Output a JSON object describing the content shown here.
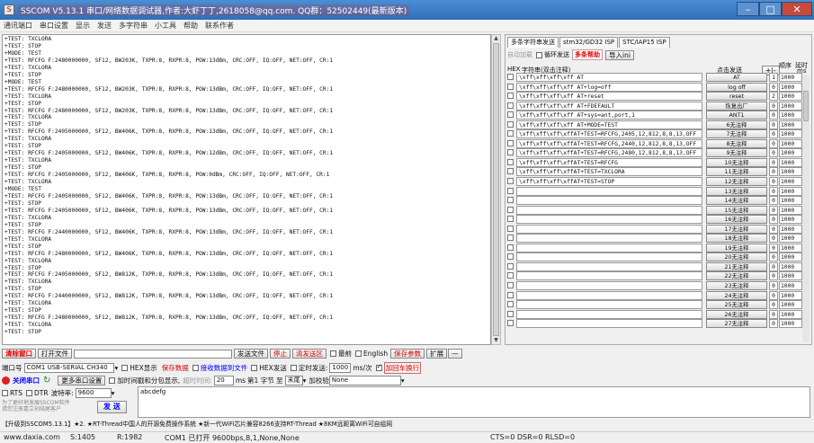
{
  "window": {
    "title": "SSCOM V5.13.1 串口/网络数据调试器,作者:大虾丁丁,2618058@qq.com. QQ群：52502449(最新版本)",
    "minimize": "–",
    "maximize": "□",
    "close": "✕"
  },
  "menu": [
    "通讯端口",
    "串口设置",
    "显示",
    "发送",
    "多字符串",
    "小工具",
    "帮助",
    "联系作者"
  ],
  "receive_text": "+TEST: TXCLORA\n+TEST: STOP\n+MODE: TEST\n+TEST: RFCFG F:2480000000, SF12, BW203K, TXPR:8, RXPR:8, POW:13dBm, CRC:OFF, IQ:OFF, NET:OFF, CR:1\n+TEST: TXCLORA\n+TEST: STOP\n+MODE: TEST\n+TEST: RFCFG F:2480000000, SF12, BW203K, TXPR:8, RXPR:8, POW:13dBm, CRC:OFF, IQ:OFF, NET:OFF, CR:1\n+TEST: TXCLORA\n+TEST: STOP\n+TEST: RFCFG F:2480000000, SF12, BW203K, TXPR:8, RXPR:8, POW:13dBm, CRC:OFF, IQ:OFF, NET:OFF, CR:1\n+TEST: TXCLORA\n+TEST: STOP\n+TEST: RFCFG F:2405000000, SF12, BW406K, TXPR:8, RXPR:8, POW:13dBm, CRC:OFF, IQ:OFF, NET:OFF, CR:1\n+TEST: TXCLORA\n+TEST: STOP\n+TEST: RFCFG F:2405000000, SF12, BW406K, TXPR:8, RXPR:8, POW:12dBm, CRC:OFF, IQ:OFF, NET:OFF, CR:1\n+TEST: TXCLORA\n+TEST: STOP\n+TEST: RFCFG F:2405000000, SF12, BW406K, TXPR:8, RXPR:8, POW:0dBm, CRC:OFF, IQ:OFF, NET:OFF, CR:1\n+TEST: TXCLORA\n+MODE: TEST\n+TEST: RFCFG F:2405000000, SF12, BW406K, TXPR:8, RXPR:8, POW:13dBm, CRC:OFF, IQ:OFF, NET:OFF, CR:1\n+TEST: STOP\n+TEST: RFCFG F:2405000000, SF12, BW406K, TXPR:8, RXPR:8, POW:13dBm, CRC:OFF, IQ:OFF, NET:OFF, CR:1\n+TEST: TXCLORA\n+TEST: STOP\n+TEST: RFCFG F:2440000000, SF12, BW406K, TXPR:8, RXPR:8, POW:13dBm, CRC:OFF, IQ:OFF, NET:OFF, CR:1\n+TEST: TXCLORA\n+TEST: STOP\n+TEST: RFCFG F:2480000000, SF12, BW406K, TXPR:8, RXPR:8, POW:13dBm, CRC:OFF, IQ:OFF, NET:OFF, CR:1\n+TEST: TXCLORA\n+TEST: STOP\n+TEST: RFCFG F:2405000000, SF12, BW812K, TXPR:8, RXPR:8, POW:13dBm, CRC:OFF, IQ:OFF, NET:OFF, CR:1\n+TEST: TXCLORA\n+TEST: STOP\n+TEST: RFCFG F:2440000000, SF12, BW812K, TXPR:8, RXPR:8, POW:13dBm, CRC:OFF, IQ:OFF, NET:OFF, CR:1\n+TEST: TXCLORA\n+TEST: STOP\n+TEST: RFCFG F:2480000000, SF12, BW812K, TXPR:8, RXPR:8, POW:13dBm, CRC:OFF, IQ:OFF, NET:OFF, CR:1\n+TEST: TXCLORA\n+TEST: STOP",
  "right_panel": {
    "tabs": [
      "多条字符串发送",
      "stm32/GD32 ISP",
      "STC/IAP15 ISP"
    ],
    "toolbar": {
      "auto_loop": "自动加载",
      "loop_send": "循环发送",
      "help": "多条帮助",
      "import": "导入ini"
    },
    "header": {
      "hex": "HEX",
      "string_col": "字符串(双击注释)",
      "send_col": "点击发送",
      "plus_minus": "+|-",
      "order": "顺序",
      "delay": "延时",
      "ms": "ms"
    },
    "rows": [
      {
        "cmd": "\\xff\\xff\\xff\\xff AT",
        "btn": "AT",
        "ord": "1",
        "dly": "1000"
      },
      {
        "cmd": "\\xff\\xff\\xff\\xff AT+log=off",
        "btn": "log off",
        "ord": "0",
        "dly": "1000"
      },
      {
        "cmd": "\\xff\\xff\\xff\\xff AT+reset",
        "btn": "reset",
        "ord": "2",
        "dly": "1000"
      },
      {
        "cmd": "\\xff\\xff\\xff\\xff AT+FDEFAULT",
        "btn": "恢复出厂",
        "ord": "0",
        "dly": "1000"
      },
      {
        "cmd": "\\xff\\xff\\xff\\xff AT+sys=ant,port,1",
        "btn": "ANT1",
        "ord": "0",
        "dly": "1000"
      },
      {
        "cmd": "\\xff\\xff\\xff\\xff AT+MODE=TEST",
        "btn": "6无注释",
        "ord": "0",
        "dly": "1000"
      },
      {
        "cmd": "\\xff\\xff\\xff\\xffAT+TEST=RFCFG,2405,12,812,8,8,13,OFF",
        "btn": "7无注释",
        "ord": "0",
        "dly": "1000"
      },
      {
        "cmd": "\\xff\\xff\\xff\\xffAT+TEST=RFCFG,2440,12,812,8,8,13,OFF",
        "btn": "8无注释",
        "ord": "0",
        "dly": "1000"
      },
      {
        "cmd": "\\xff\\xff\\xff\\xffAT+TEST=RFCFG,2480,12,812,8,8,13,OFF",
        "btn": "9无注释",
        "ord": "0",
        "dly": "1000"
      },
      {
        "cmd": "\\xff\\xff\\xff\\xffAT+TEST=RFCFG",
        "btn": "10无注释",
        "ord": "0",
        "dly": "1000"
      },
      {
        "cmd": "\\xff\\xff\\xff\\xffAT+TEST=TXCLORA",
        "btn": "11无注释",
        "ord": "0",
        "dly": "1000"
      },
      {
        "cmd": "\\xff\\xff\\xff\\xffAT+TEST=STOP",
        "btn": "12无注释",
        "ord": "0",
        "dly": "1000"
      },
      {
        "cmd": "",
        "btn": "13无注释",
        "ord": "0",
        "dly": "1000"
      },
      {
        "cmd": "",
        "btn": "14无注释",
        "ord": "0",
        "dly": "1000"
      },
      {
        "cmd": "",
        "btn": "15无注释",
        "ord": "0",
        "dly": "1000"
      },
      {
        "cmd": "",
        "btn": "16无注释",
        "ord": "0",
        "dly": "1000"
      },
      {
        "cmd": "",
        "btn": "17无注释",
        "ord": "0",
        "dly": "1000"
      },
      {
        "cmd": "",
        "btn": "18无注释",
        "ord": "0",
        "dly": "1000"
      },
      {
        "cmd": "",
        "btn": "19无注释",
        "ord": "0",
        "dly": "1000"
      },
      {
        "cmd": "",
        "btn": "20无注释",
        "ord": "0",
        "dly": "1000"
      },
      {
        "cmd": "",
        "btn": "21无注释",
        "ord": "0",
        "dly": "1000"
      },
      {
        "cmd": "",
        "btn": "22无注释",
        "ord": "0",
        "dly": "1000"
      },
      {
        "cmd": "",
        "btn": "23无注释",
        "ord": "0",
        "dly": "1000"
      },
      {
        "cmd": "",
        "btn": "24无注释",
        "ord": "0",
        "dly": "1000"
      },
      {
        "cmd": "",
        "btn": "25无注释",
        "ord": "0",
        "dly": "1000"
      },
      {
        "cmd": "",
        "btn": "26无注释",
        "ord": "0",
        "dly": "1000"
      },
      {
        "cmd": "",
        "btn": "27无注释",
        "ord": "0",
        "dly": "1000"
      }
    ]
  },
  "bottom": {
    "clear_window": "清除窗口",
    "open_file": "打开文件",
    "send_file": "发送文件",
    "stop": "停止",
    "clear_send": "清发送区",
    "latest": "最前",
    "english": "English",
    "save_params": "保存参数",
    "expand": "扩展",
    "collapse": "—",
    "port_label": "端口号",
    "port_value": "COM1 USB-SERIAL CH340",
    "hex_display": "HEX显示",
    "save_data": "保存数据",
    "recv_to_file": "接收数据到文件",
    "hex_send": "HEX发送",
    "timed_send": "定时发送:",
    "timed_value": "1000",
    "ms_per": "ms/次",
    "add_crlf": "加回车换行",
    "close_port": "关闭串口",
    "more_settings": "更多串口设置",
    "timestamp": "加时间戳和分包显示,",
    "timeout_label": "超时时间:",
    "timeout_value": "20",
    "ms_label": "ms",
    "nth": "第",
    "byte_label": "1 字节 至",
    "end_label": "末尾",
    "checksum_label": "加校验",
    "checksum_value": "None",
    "rts": "RTS",
    "dtr": "DTR",
    "baud_label": "波特率:",
    "baud_value": "9600",
    "send_text": "abcdefg",
    "send_btn": "发 送",
    "promo_note": "为了更好地发展SSCOM软件\n请您注册嘉立创结尾客户",
    "ad_line": "【升级到SSCOM5.13.1】★2. ★RT-Thread中国人的开源免费操作系统 ★新一代WiFi芯片兼容8266支持RT-Thread ★8KM远距离WiFi可自组网"
  },
  "status": {
    "site": "www.daxia.com",
    "s": "S:1405",
    "r": "R:1982",
    "port": "COM1 已打开  9600bps,8,1,None,None",
    "lines": "CTS=0 DSR=0 RLSD=0"
  },
  "colors": {
    "titlebar": "#2f6fb8",
    "accent_red": "#d00000",
    "status_led": "#e02020"
  }
}
